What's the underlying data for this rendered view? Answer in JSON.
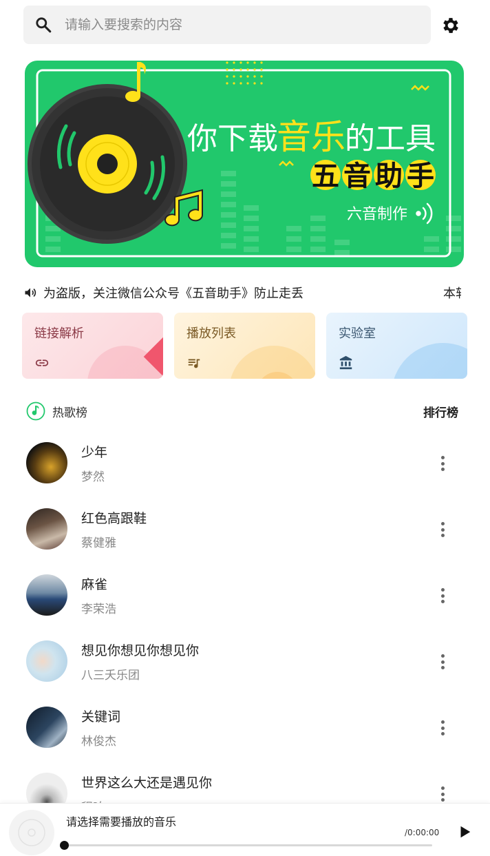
{
  "search": {
    "placeholder": "请输入要搜索的内容",
    "value": ""
  },
  "banner": {
    "line1_a": "你下载",
    "line1_b": "音乐",
    "line1_c": "的工具",
    "chars": [
      "五",
      "音",
      "助",
      "手"
    ],
    "maker": "六音制作",
    "colors": {
      "bg": "#21c86c",
      "accent": "#ffe11a"
    }
  },
  "notice": {
    "text": "为盗版，关注微信公众号《五音助手》防止走丢",
    "text2": "本软"
  },
  "features": [
    {
      "label": "链接解析",
      "icon": "link-icon"
    },
    {
      "label": "播放列表",
      "icon": "playlist-icon"
    },
    {
      "label": "实验室",
      "icon": "bank-icon"
    }
  ],
  "hot": {
    "title": "热歌榜",
    "rank_link": "排行榜"
  },
  "songs": [
    {
      "title": "少年",
      "artist": "梦然"
    },
    {
      "title": "红色高跟鞋",
      "artist": "蔡健雅"
    },
    {
      "title": "麻雀",
      "artist": "李荣浩"
    },
    {
      "title": "想见你想见你想见你",
      "artist": "八三夭乐团"
    },
    {
      "title": "关键词",
      "artist": "林俊杰"
    },
    {
      "title": "世界这么大还是遇见你",
      "artist": "程响"
    }
  ],
  "player": {
    "prompt": "请选择需要播放的音乐",
    "time": "/0:00:00",
    "progress": 0
  }
}
